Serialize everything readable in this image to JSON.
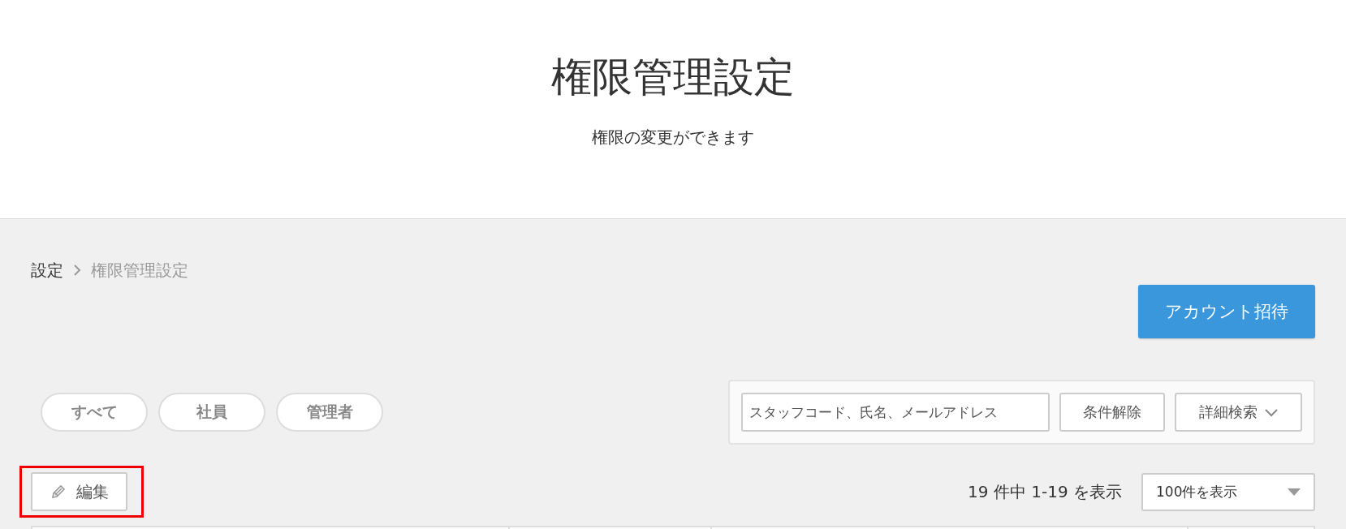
{
  "header": {
    "title": "権限管理設定",
    "subtitle": "権限の変更ができます"
  },
  "breadcrumb": [
    {
      "label": "設定",
      "current": false
    },
    {
      "label": "権限管理設定",
      "current": true
    }
  ],
  "invite_button": "アカウント招待",
  "filters": [
    {
      "label": "すべて"
    },
    {
      "label": "社員"
    },
    {
      "label": "管理者"
    }
  ],
  "search": {
    "placeholder": "スタッフコード、氏名、メールアドレス",
    "clear_button": "条件解除",
    "advanced_button": "詳細検索"
  },
  "edit_button": {
    "label": "編集",
    "highlighted": true
  },
  "count_text": "19 件中 1-19 を表示",
  "page_size": "100件を表示"
}
